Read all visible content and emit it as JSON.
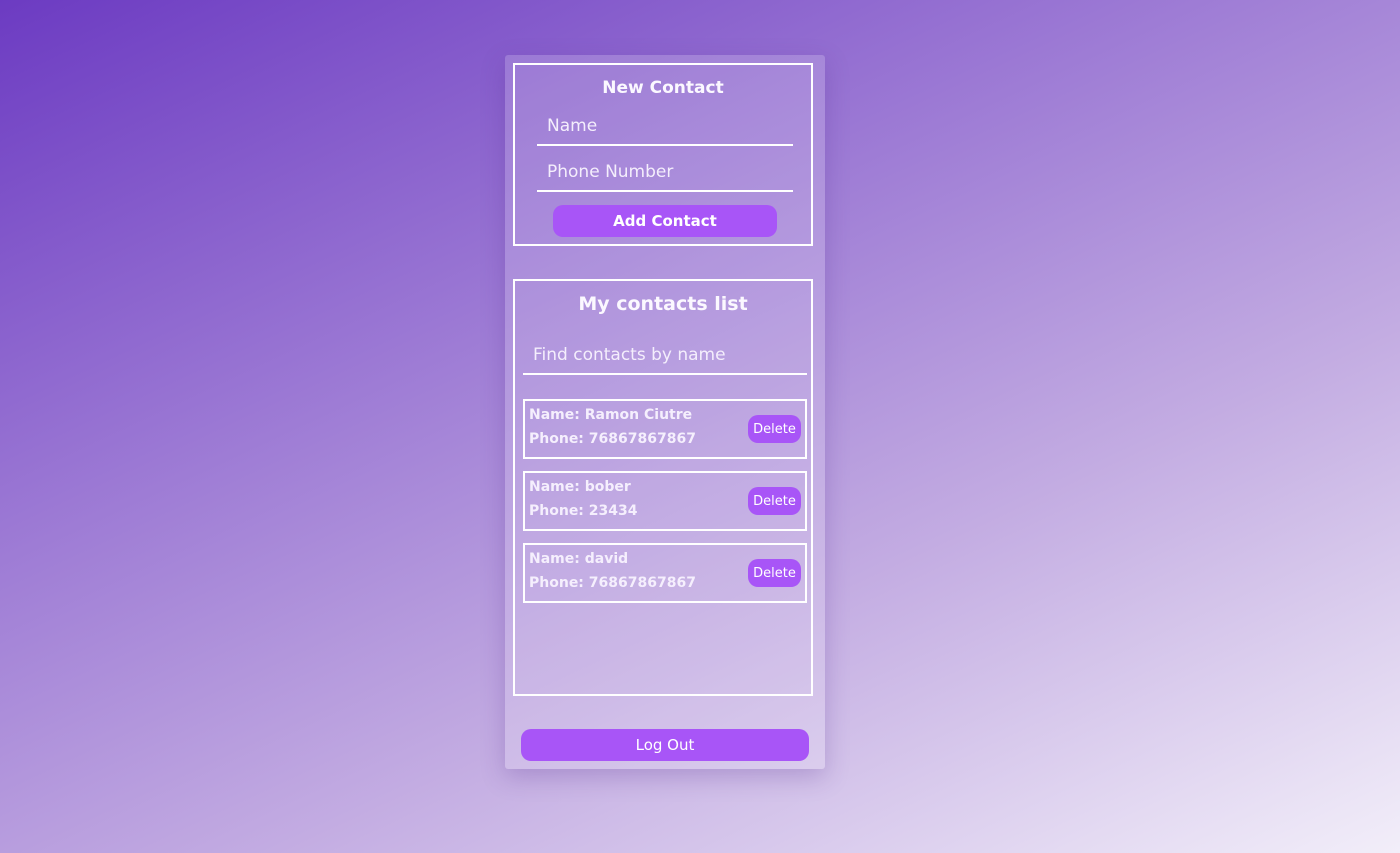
{
  "new_contact": {
    "title": "New Contact",
    "name_placeholder": "Name",
    "phone_placeholder": "Phone Number",
    "add_button_label": "Add Contact"
  },
  "contacts": {
    "title": "My contacts list",
    "search_placeholder": "Find contacts by name",
    "items": [
      {
        "name_line": "Name: Ramon Ciutre",
        "phone_line": "Phone: 76867867867",
        "delete_label": "Delete"
      },
      {
        "name_line": "Name: bober",
        "phone_line": "Phone: 23434",
        "delete_label": "Delete"
      },
      {
        "name_line": "Name: david",
        "phone_line": "Phone: 76867867867",
        "delete_label": "Delete"
      }
    ]
  },
  "logout_label": "Log Out",
  "colors": {
    "accent": "#a855f7",
    "border": "#ffffff",
    "background_start": "#6c3bc2",
    "background_end": "#f2eef9"
  }
}
